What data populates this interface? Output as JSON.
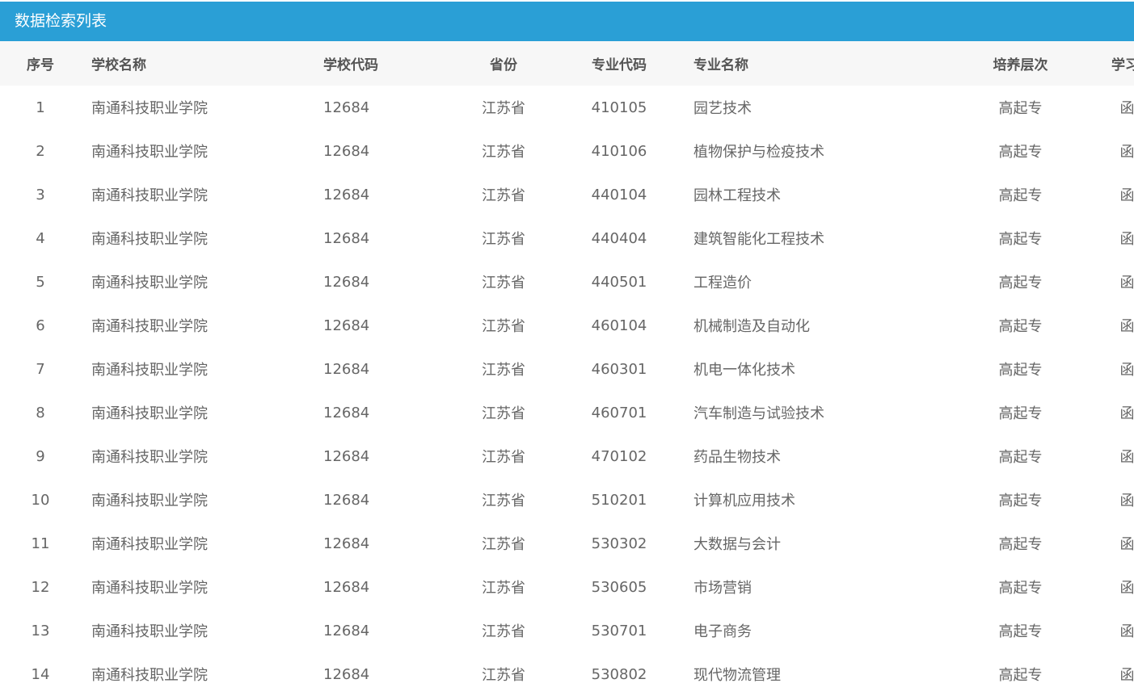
{
  "title": "数据检索列表",
  "columns": {
    "no": "序号",
    "school": "学校名称",
    "school_code": "学校代码",
    "province": "省份",
    "major_code": "专业代码",
    "major_name": "专业名称",
    "level": "培养层次",
    "study_form": "学习形式"
  },
  "rows": [
    {
      "no": "1",
      "school": "南通科技职业学院",
      "school_code": "12684",
      "province": "江苏省",
      "major_code": "410105",
      "major_name": "园艺技术",
      "level": "高起专",
      "study_form": "函授"
    },
    {
      "no": "2",
      "school": "南通科技职业学院",
      "school_code": "12684",
      "province": "江苏省",
      "major_code": "410106",
      "major_name": "植物保护与检疫技术",
      "level": "高起专",
      "study_form": "函授"
    },
    {
      "no": "3",
      "school": "南通科技职业学院",
      "school_code": "12684",
      "province": "江苏省",
      "major_code": "440104",
      "major_name": "园林工程技术",
      "level": "高起专",
      "study_form": "函授"
    },
    {
      "no": "4",
      "school": "南通科技职业学院",
      "school_code": "12684",
      "province": "江苏省",
      "major_code": "440404",
      "major_name": "建筑智能化工程技术",
      "level": "高起专",
      "study_form": "函授"
    },
    {
      "no": "5",
      "school": "南通科技职业学院",
      "school_code": "12684",
      "province": "江苏省",
      "major_code": "440501",
      "major_name": "工程造价",
      "level": "高起专",
      "study_form": "函授"
    },
    {
      "no": "6",
      "school": "南通科技职业学院",
      "school_code": "12684",
      "province": "江苏省",
      "major_code": "460104",
      "major_name": "机械制造及自动化",
      "level": "高起专",
      "study_form": "函授"
    },
    {
      "no": "7",
      "school": "南通科技职业学院",
      "school_code": "12684",
      "province": "江苏省",
      "major_code": "460301",
      "major_name": "机电一体化技术",
      "level": "高起专",
      "study_form": "函授"
    },
    {
      "no": "8",
      "school": "南通科技职业学院",
      "school_code": "12684",
      "province": "江苏省",
      "major_code": "460701",
      "major_name": "汽车制造与试验技术",
      "level": "高起专",
      "study_form": "函授"
    },
    {
      "no": "9",
      "school": "南通科技职业学院",
      "school_code": "12684",
      "province": "江苏省",
      "major_code": "470102",
      "major_name": "药品生物技术",
      "level": "高起专",
      "study_form": "函授"
    },
    {
      "no": "10",
      "school": "南通科技职业学院",
      "school_code": "12684",
      "province": "江苏省",
      "major_code": "510201",
      "major_name": "计算机应用技术",
      "level": "高起专",
      "study_form": "函授"
    },
    {
      "no": "11",
      "school": "南通科技职业学院",
      "school_code": "12684",
      "province": "江苏省",
      "major_code": "530302",
      "major_name": "大数据与会计",
      "level": "高起专",
      "study_form": "函授"
    },
    {
      "no": "12",
      "school": "南通科技职业学院",
      "school_code": "12684",
      "province": "江苏省",
      "major_code": "530605",
      "major_name": "市场营销",
      "level": "高起专",
      "study_form": "函授"
    },
    {
      "no": "13",
      "school": "南通科技职业学院",
      "school_code": "12684",
      "province": "江苏省",
      "major_code": "530701",
      "major_name": "电子商务",
      "level": "高起专",
      "study_form": "函授"
    },
    {
      "no": "14",
      "school": "南通科技职业学院",
      "school_code": "12684",
      "province": "江苏省",
      "major_code": "530802",
      "major_name": "现代物流管理",
      "level": "高起专",
      "study_form": "函授"
    }
  ]
}
